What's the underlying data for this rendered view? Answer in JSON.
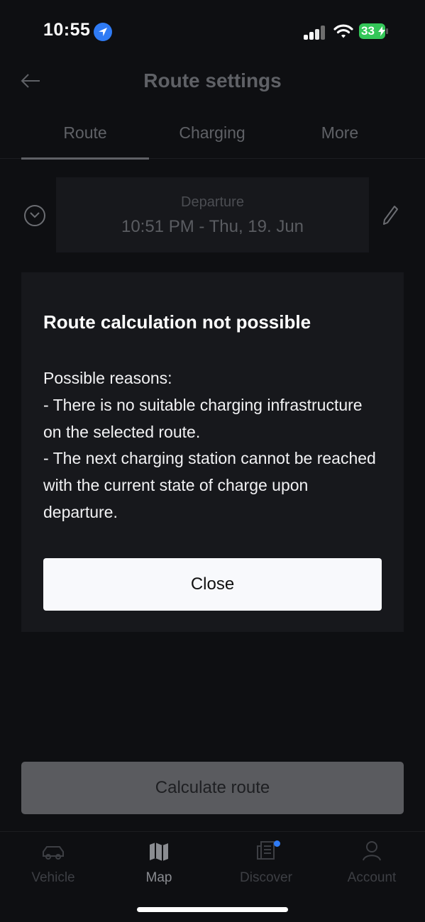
{
  "status_bar": {
    "time": "10:55",
    "battery": "33",
    "icons": [
      "location-arrow-icon",
      "cellular-signal-icon",
      "wifi-icon",
      "battery-charging-icon"
    ]
  },
  "header": {
    "title": "Route settings",
    "back_icon": "arrow-left-icon"
  },
  "tabs": [
    {
      "label": "Route",
      "active": true
    },
    {
      "label": "Charging",
      "active": false
    },
    {
      "label": "More",
      "active": false
    }
  ],
  "departure": {
    "label": "Departure",
    "value": "10:51 PM - Thu, 19. Jun",
    "expand_icon": "chevron-down-circle-icon",
    "edit_icon": "pencil-icon"
  },
  "modal": {
    "title": "Route calculation not possible",
    "body_lines": [
      "Possible reasons:",
      "- There is no suitable charging infrastructure",
      "on the selected route.",
      "- The next charging station cannot be reached",
      "with the current state of charge upon",
      "departure."
    ],
    "close_label": "Close"
  },
  "calculate_button": "Calculate route",
  "bottom_nav": [
    {
      "label": "Vehicle",
      "icon": "car-icon",
      "active": false
    },
    {
      "label": "Map",
      "icon": "map-icon",
      "active": true
    },
    {
      "label": "Discover",
      "icon": "discover-icon",
      "active": false,
      "badge": true
    },
    {
      "label": "Account",
      "icon": "user-icon",
      "active": false
    }
  ],
  "colors": {
    "background": "#0e0f12",
    "card": "#17181c",
    "accent_blue": "#2f7bf5",
    "battery_green": "#34c759"
  }
}
